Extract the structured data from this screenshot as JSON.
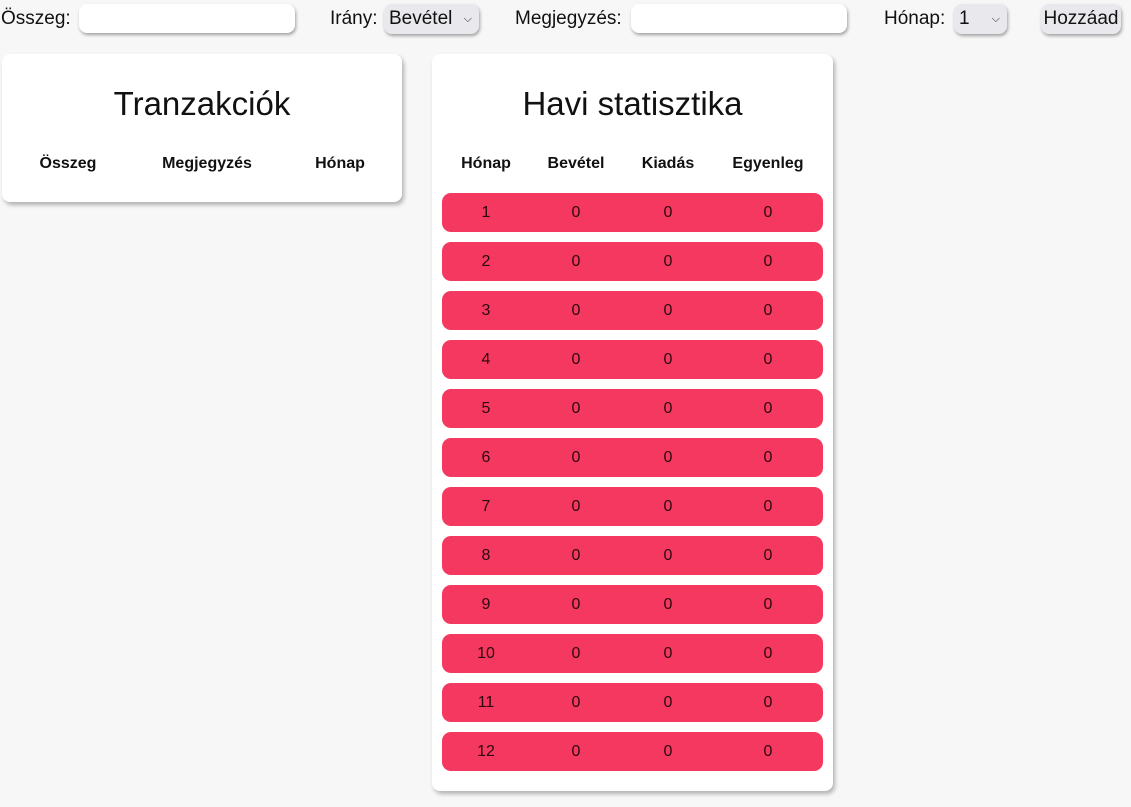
{
  "form": {
    "amount_label": "Összeg:",
    "amount_value": "",
    "direction_label": "Irány:",
    "direction_selected": "Bevétel",
    "note_label": "Megjegyzés:",
    "note_value": "",
    "month_label": "Hónap:",
    "month_selected": "1",
    "add_button": "Hozzáad"
  },
  "transactions": {
    "title": "Tranzakciók",
    "columns": [
      "Összeg",
      "Megjegyzés",
      "Hónap"
    ]
  },
  "stats": {
    "title": "Havi statisztika",
    "columns": [
      "Hónap",
      "Bevétel",
      "Kiadás",
      "Egyenleg"
    ],
    "rows": [
      {
        "month": "1",
        "income": "0",
        "expense": "0",
        "balance": "0"
      },
      {
        "month": "2",
        "income": "0",
        "expense": "0",
        "balance": "0"
      },
      {
        "month": "3",
        "income": "0",
        "expense": "0",
        "balance": "0"
      },
      {
        "month": "4",
        "income": "0",
        "expense": "0",
        "balance": "0"
      },
      {
        "month": "5",
        "income": "0",
        "expense": "0",
        "balance": "0"
      },
      {
        "month": "6",
        "income": "0",
        "expense": "0",
        "balance": "0"
      },
      {
        "month": "7",
        "income": "0",
        "expense": "0",
        "balance": "0"
      },
      {
        "month": "8",
        "income": "0",
        "expense": "0",
        "balance": "0"
      },
      {
        "month": "9",
        "income": "0",
        "expense": "0",
        "balance": "0"
      },
      {
        "month": "10",
        "income": "0",
        "expense": "0",
        "balance": "0"
      },
      {
        "month": "11",
        "income": "0",
        "expense": "0",
        "balance": "0"
      },
      {
        "month": "12",
        "income": "0",
        "expense": "0",
        "balance": "0"
      }
    ]
  },
  "colors": {
    "row_background": "#f5385f",
    "page_background": "#f7f7f7",
    "card_background": "#ffffff"
  },
  "icons": {
    "select_arrow": "chevron-down-icon"
  }
}
